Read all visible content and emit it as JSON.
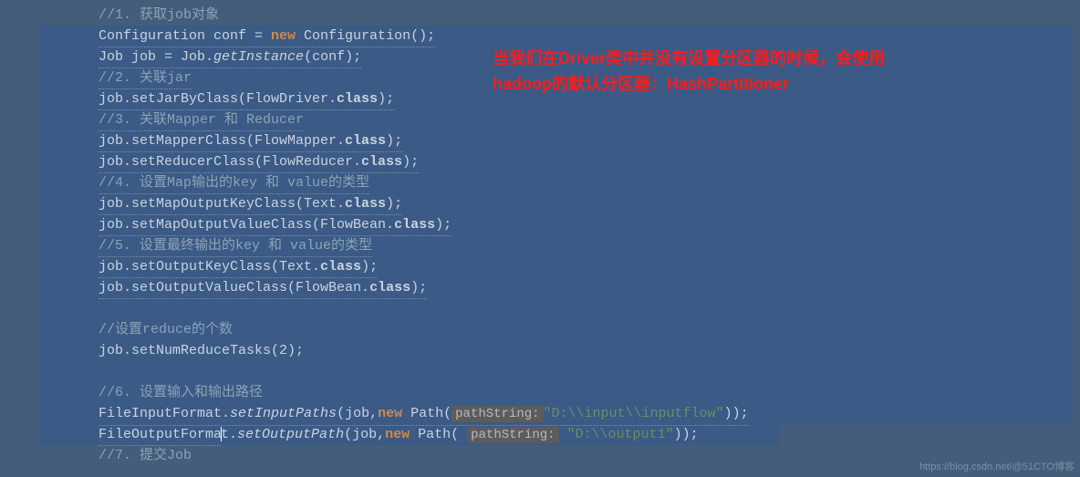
{
  "annotation": {
    "line1": "当我们在Driver类中并没有设置分区器的时候，会使用",
    "line2": "hadoop的默认分区器：HashPartitioner"
  },
  "watermark": "https://blog.csdn.net/@51CTO博客",
  "code": {
    "l01_comment": "//1. 获取job对象",
    "l02_a": "Configuration conf = ",
    "l02_kw": "new",
    "l02_b": " Configuration();",
    "l03": "Job job = Job.",
    "l03_m": "getInstance",
    "l03_c": "(conf);",
    "l04_comment": "//2. 关联jar",
    "l05": "job.setJarByClass(FlowDriver.",
    "l05_b": "class",
    "l05_c": ");",
    "l06_comment": "//3. 关联Mapper 和 Reducer",
    "l07": "job.setMapperClass(FlowMapper.",
    "l07_b": "class",
    "l07_c": ");",
    "l08": "job.setReducerClass(FlowReducer.",
    "l08_b": "class",
    "l08_c": ");",
    "l09_comment": "//4. 设置Map输出的key 和 value的类型",
    "l10": "job.setMapOutputKeyClass(Text.",
    "l10_b": "class",
    "l10_c": ");",
    "l11": "job.setMapOutputValueClass(FlowBean.",
    "l11_b": "class",
    "l11_c": ");",
    "l12_comment": "//5. 设置最终输出的key 和 value的类型",
    "l13": "job.setOutputKeyClass(Text.",
    "l13_b": "class",
    "l13_c": ");",
    "l14": "job.setOutputValueClass(FlowBean.",
    "l14_b": "class",
    "l14_c": ");",
    "l15_blank": "",
    "l16_comment": "//设置reduce的个数",
    "l17": "job.setNumReduceTasks(2);",
    "l18_blank": "",
    "l19_comment": "//6. 设置输入和输出路径",
    "l20_a": "FileInputFormat.",
    "l20_m": "setInputPaths",
    "l20_b": "(job,",
    "l20_kw": "new",
    "l20_c": " Path(",
    "l20_hint": "pathString:",
    "l20_str": "\"D:\\\\input\\\\inputflow\"",
    "l20_d": "));",
    "l21_a": "FileOutputForma",
    "l21_a2": "t.",
    "l21_m": "setOutputPath",
    "l21_b": "(job,",
    "l21_kw": "new",
    "l21_c": " Path( ",
    "l21_hint": "pathString:",
    "l21_str": " \"D:\\\\output1\"",
    "l21_d": "));",
    "l22_comment": "//7. 提交Job"
  }
}
